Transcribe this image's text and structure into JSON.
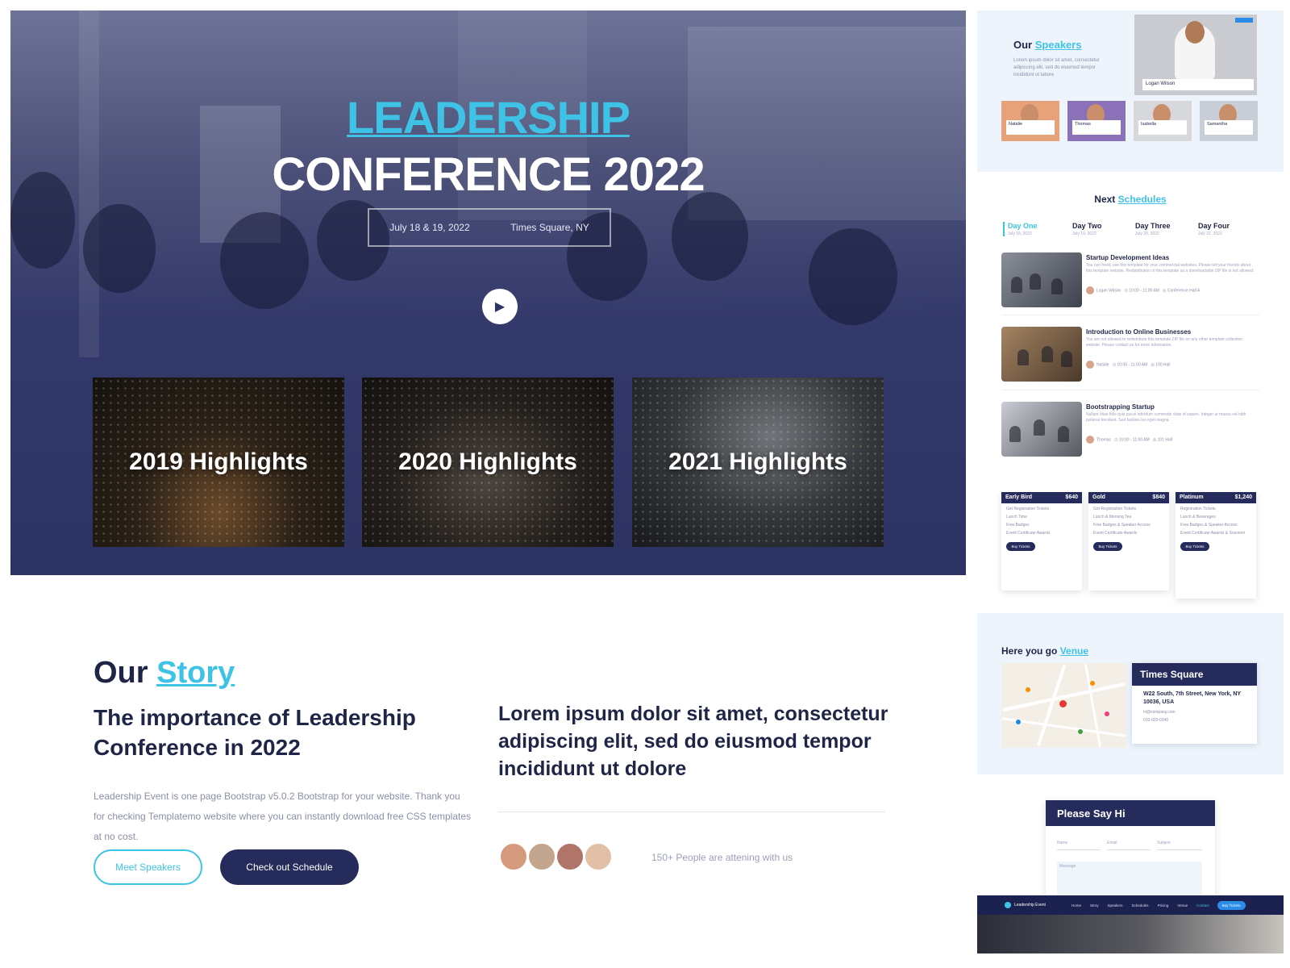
{
  "hero": {
    "title_line1": "LEADERSHIP",
    "title_line2": "CONFERENCE 2022",
    "date": "July 18 & 19, 2022",
    "location": "Times Square, NY",
    "play_icon": "play-icon",
    "highlights": [
      "2019 Highlights",
      "2020 Highlights",
      "2021 Highlights"
    ]
  },
  "story": {
    "heading_prefix": "Our",
    "heading_accent": "Story",
    "subheading": "The importance of Leadership Conference in 2022",
    "body": "Leadership Event is one page Bootstrap v5.0.2 Bootstrap for your website. Thank you for checking Templatemo website where you can instantly download free CSS templates at no cost.",
    "btn_speakers": "Meet Speakers",
    "btn_schedule": "Check out Schedule",
    "quote": "Lorem ipsum dolor sit amet, consectetur adipiscing elit, sed do eiusmod tempor incididunt ut dolore",
    "people_text": "150+ People are attening with us"
  },
  "speakers": {
    "title_prefix": "Our",
    "title_accent": "Speakers",
    "description": "Lorem ipsum dolor sit amet, consectetur adipiscing elit, sed do eiusmod tempor incididunt ut labore",
    "featured": {
      "name": "Logan Wilson"
    },
    "thumbs": [
      {
        "name": "Natalie",
        "bg": "#e8a27a"
      },
      {
        "name": "Thomas",
        "bg": "#8b72b8"
      },
      {
        "name": "Isabella",
        "bg": "#d6d8dc"
      },
      {
        "name": "Samantha",
        "bg": "#c9ced6"
      }
    ]
  },
  "schedule": {
    "title_prefix": "Next",
    "title_accent": "Schedules",
    "tabs": [
      {
        "label": "Day One",
        "date": "July 18, 2022"
      },
      {
        "label": "Day Two",
        "date": "July 19, 2022"
      },
      {
        "label": "Day Three",
        "date": "July 20, 2022"
      },
      {
        "label": "Day Four",
        "date": "July 21, 2022"
      }
    ],
    "items": [
      {
        "title": "Startup Development Ideas",
        "desc": "You can freely use this template for your commercial websites. Please tell your friends about this template website. Redistribution of this template as a downloadable ZIP file is not allowed.",
        "speaker": "Logan Wilson",
        "time": "10:00 - 11:00 AM",
        "place": "Conference Hall A"
      },
      {
        "title": "Introduction to Online Businesses",
        "desc": "You are not allowed to redistribute this template ZIP file on any other template collection website. Please contact us for more information.",
        "speaker": "Natalie",
        "time": "10:00 - 11:00 AM",
        "place": "100 Hall"
      },
      {
        "title": "Bootstrapping Startup",
        "desc": "Nullam vitae felis quis purus interdum commodo vitae id sapien. Integer ut massa vel nibh pulvinar tincidunt. Sed facilisis leo eget magna.",
        "speaker": "Thomas",
        "time": "10:00 - 11:00 AM",
        "place": "101 Hall"
      }
    ]
  },
  "pricing": {
    "cards": [
      {
        "name": "Early Bird",
        "price": "$640",
        "lines": [
          "Get Registration Tickets",
          "Lunch Time",
          "Free Badges",
          "Event Certificate Awards"
        ],
        "btn": "Buy Tickets"
      },
      {
        "name": "Gold",
        "price": "$840",
        "lines": [
          "Get Registration Tickets",
          "Lunch & Morning Tea",
          "Free Badges & Speaker Access",
          "Event Certificate Awards"
        ],
        "btn": "Buy Tickets"
      },
      {
        "name": "Platinum",
        "price": "$1,240",
        "lines": [
          "Registration Tickets",
          "Lunch & Beverages",
          "Free Badges & Speaker Access",
          "Event Certificate Awards & Souvenir"
        ],
        "btn": "Buy Tickets"
      }
    ]
  },
  "venue": {
    "title_prefix": "Here you go",
    "title_accent": "Venue",
    "name": "Times Square",
    "address": "W22 South, 7th Street, New York, NY 10036, USA",
    "email": "hi@company.com",
    "phone": "010-020-0340"
  },
  "contact": {
    "title": "Please Say Hi",
    "name_placeholder": "Name",
    "email_placeholder": "Email",
    "subject_placeholder": "Subject",
    "message_placeholder": "Message"
  },
  "navbar": {
    "brand": "Leadership Event",
    "links": [
      "Home",
      "Story",
      "Speakers",
      "Schedules",
      "Pricing",
      "Venue",
      "Contact"
    ],
    "active_link": "Contact",
    "buy_label": "Buy Tickets"
  }
}
